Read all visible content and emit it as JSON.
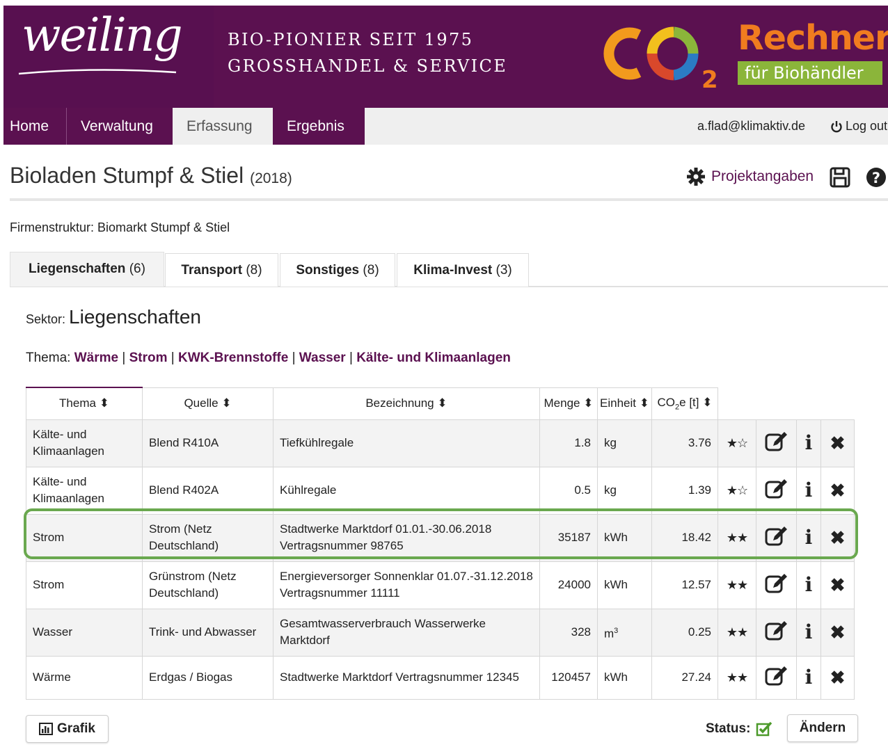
{
  "header": {
    "logo_text": "weiling",
    "tagline_1": "BIO-PIONIER SEIT 1975",
    "tagline_2": "GROSSHANDEL & SERVICE",
    "co2_text": "CO",
    "co2_sub": "2",
    "rechner": "Rechner",
    "fuer": "für Biohändler"
  },
  "nav": {
    "items": [
      "Home",
      "Verwaltung",
      "Erfassung",
      "Ergebnis"
    ],
    "active": "Erfassung",
    "user": "a.flad@klimaktiv.de",
    "logout": "Log out"
  },
  "page": {
    "title": "Bioladen Stumpf & Stiel",
    "year": "(2018)",
    "projekt_label": "Projektangaben",
    "firmenstruktur": "Firmenstruktur: Biomarkt Stumpf & Stiel"
  },
  "tabs": [
    {
      "label": "Liegenschaften",
      "count": "(6)"
    },
    {
      "label": "Transport",
      "count": "(8)"
    },
    {
      "label": "Sonstiges",
      "count": "(8)"
    },
    {
      "label": "Klima-Invest",
      "count": "(3)"
    }
  ],
  "sektor": {
    "prefix": "Sektor:",
    "name": "Liegenschaften"
  },
  "thema": {
    "prefix": "Thema:",
    "links": [
      "Wärme",
      "Strom",
      "KWK-Brennstoffe",
      "Wasser",
      "Kälte- und Klimaanlagen"
    ]
  },
  "table": {
    "headers": [
      "Thema",
      "Quelle",
      "Bezeichnung",
      "Menge",
      "Einheit",
      "CO2e [t]"
    ],
    "rows": [
      {
        "thema": "Kälte- und Klimaanlagen",
        "quelle": "Blend R410A",
        "bezeichnung": "Tiefkühlregale",
        "menge": "1.8",
        "einheit": "kg",
        "co2": "3.76",
        "stars": 1
      },
      {
        "thema": "Kälte- und Klimaanlagen",
        "quelle": "Blend R402A",
        "bezeichnung": "Kühlregale",
        "menge": "0.5",
        "einheit": "kg",
        "co2": "1.39",
        "stars": 1
      },
      {
        "thema": "Strom",
        "quelle": "Strom (Netz Deutschland)",
        "bezeichnung": "Stadtwerke Marktdorf 01.01.-30.06.2018 Vertragsnummer 98765",
        "menge": "35187",
        "einheit": "kWh",
        "co2": "18.42",
        "stars": 2
      },
      {
        "thema": "Strom",
        "quelle": "Grünstrom (Netz Deutschland)",
        "bezeichnung": "Energieversorger Sonnenklar 01.07.-31.12.2018 Vertragsnummer 11111",
        "menge": "24000",
        "einheit": "kWh",
        "co2": "12.57",
        "stars": 2
      },
      {
        "thema": "Wasser",
        "quelle": "Trink- und Abwasser",
        "bezeichnung": "Gesamtwasserverbrauch Wasserwerke Marktdorf",
        "menge": "328",
        "einheit": "m³",
        "co2": "0.25",
        "stars": 2
      },
      {
        "thema": "Wärme",
        "quelle": "Erdgas / Biogas",
        "bezeichnung": "Stadtwerke Marktdorf Vertragsnummer 12345",
        "menge": "120457",
        "einheit": "kWh",
        "co2": "27.24",
        "stars": 2
      }
    ]
  },
  "footer": {
    "grafik": "Grafik",
    "status_label": "Status:",
    "aendern": "Ändern"
  },
  "colors": {
    "brand_purple": "#5b1150",
    "highlight_green": "#6aa84f",
    "rechner_orange": "#f07c1f",
    "badge_green": "#8bb53a"
  }
}
